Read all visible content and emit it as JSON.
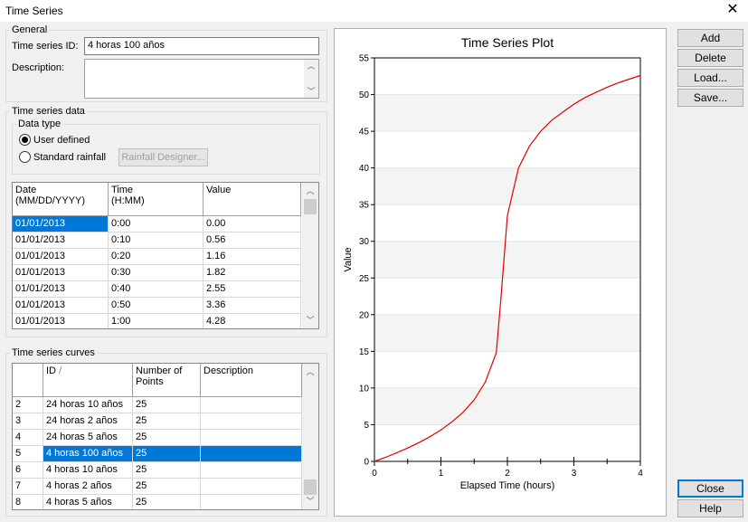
{
  "window": {
    "title": "Time Series"
  },
  "general": {
    "label": "General",
    "id_label": "Time series ID:",
    "id_value": "4 horas 100 años",
    "description_label": "Description:",
    "description_value": ""
  },
  "ts_data": {
    "label": "Time series data",
    "data_type_label": "Data type",
    "user_defined": "User defined",
    "standard_rainfall": "Standard rainfall",
    "rainfall_designer": "Rainfall Designer...",
    "columns": [
      "Date\n(MM/DD/YYYY)",
      "Time\n(H:MM)",
      "Value"
    ],
    "rows": [
      [
        "01/01/2013",
        "0:00",
        "0.00"
      ],
      [
        "01/01/2013",
        "0:10",
        "0.56"
      ],
      [
        "01/01/2013",
        "0:20",
        "1.16"
      ],
      [
        "01/01/2013",
        "0:30",
        "1.82"
      ],
      [
        "01/01/2013",
        "0:40",
        "2.55"
      ],
      [
        "01/01/2013",
        "0:50",
        "3.36"
      ],
      [
        "01/01/2013",
        "1:00",
        "4.28"
      ]
    ]
  },
  "curves": {
    "label": "Time series curves",
    "columns": [
      "",
      "ID",
      "Number of\nPoints",
      "Description"
    ],
    "sort_glyph": "/",
    "rows": [
      [
        "2",
        "24 horas 10 años",
        "25",
        ""
      ],
      [
        "3",
        "24 horas 2 años",
        "25",
        ""
      ],
      [
        "4",
        "24 horas 5 años",
        "25",
        ""
      ],
      [
        "5",
        "4 horas 100 años",
        "25",
        ""
      ],
      [
        "6",
        "4 horas 10 años",
        "25",
        ""
      ],
      [
        "7",
        "4 horas 2 años",
        "25",
        ""
      ],
      [
        "8",
        "4 horas 5 años",
        "25",
        ""
      ]
    ],
    "selected_index": 3
  },
  "buttons": {
    "add": "Add",
    "delete": "Delete",
    "load": "Load...",
    "save": "Save...",
    "close": "Close",
    "help": "Help"
  },
  "chart_data": {
    "type": "line",
    "title": "Time Series Plot",
    "xlabel": "Elapsed Time (hours)",
    "ylabel": "Value",
    "xlim": [
      0,
      4
    ],
    "ylim": [
      0,
      55
    ],
    "xticks": [
      0,
      1,
      2,
      3,
      4
    ],
    "yticks": [
      0,
      5,
      10,
      15,
      20,
      25,
      30,
      35,
      40,
      45,
      50,
      55
    ],
    "grid": true,
    "series": [
      {
        "color": "#e00000",
        "x": [
          0,
          0.1667,
          0.3333,
          0.5,
          0.6667,
          0.8333,
          1.0,
          1.1667,
          1.3333,
          1.5,
          1.6667,
          1.8333,
          1.9,
          2.0,
          2.1667,
          2.3333,
          2.5,
          2.6667,
          2.8333,
          3.0,
          3.1667,
          3.3333,
          3.5,
          3.6667,
          3.8333,
          4.0
        ],
        "y": [
          0.0,
          0.56,
          1.16,
          1.82,
          2.55,
          3.36,
          4.28,
          5.4,
          6.7,
          8.4,
          10.8,
          14.8,
          22.0,
          33.5,
          40.0,
          43.0,
          45.0,
          46.5,
          47.6,
          48.7,
          49.6,
          50.3,
          51.0,
          51.6,
          52.1,
          52.6
        ]
      }
    ]
  }
}
